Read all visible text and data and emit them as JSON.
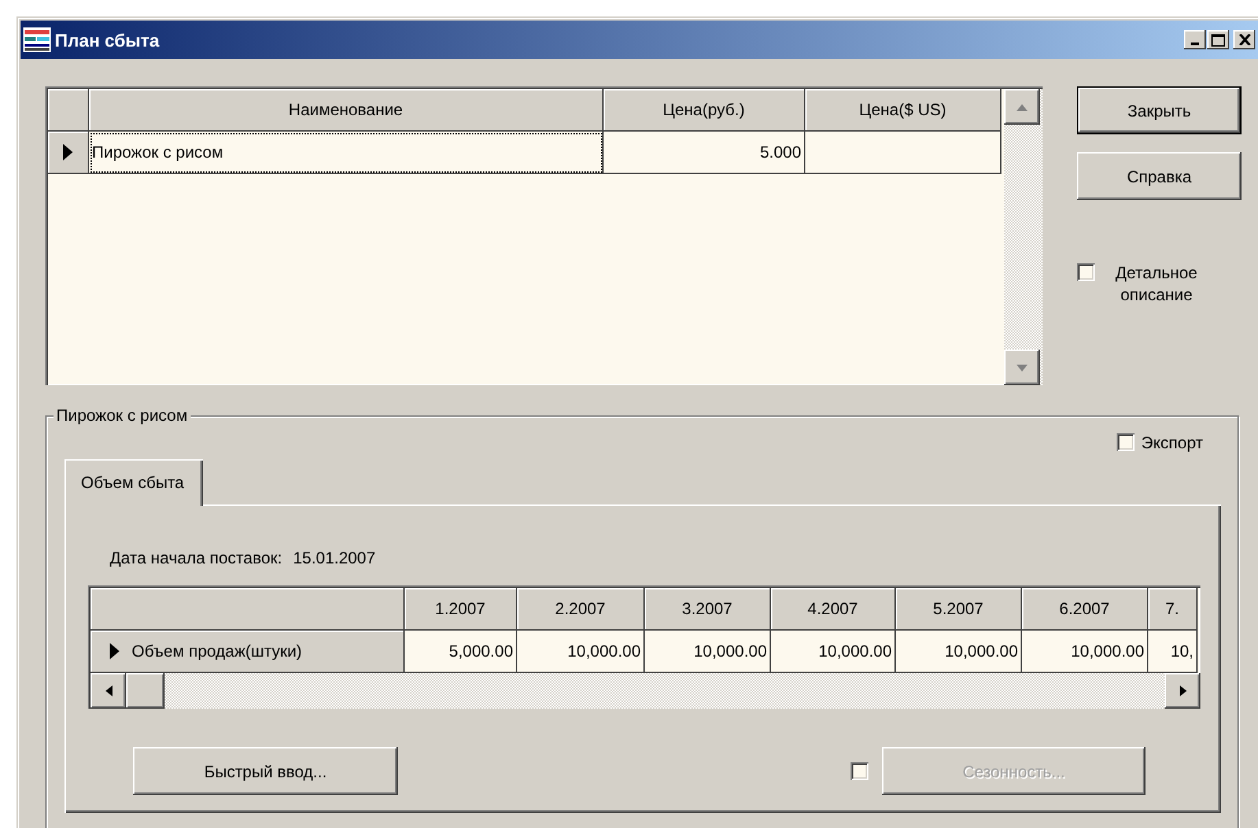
{
  "window": {
    "title": "План сбыта"
  },
  "products_table": {
    "columns": [
      "Наименование",
      "Цена(руб.)",
      "Цена($ US)"
    ],
    "rows": [
      {
        "selected": true,
        "cells": [
          "Пирожок с рисом",
          "5.000"
        ]
      }
    ]
  },
  "buttons": [
    {
      "label": "Закрыть",
      "default": true
    },
    {
      "label": "Справка",
      "default": false
    }
  ],
  "detail_checkbox": {
    "label": "Детальное описание",
    "checked": false
  },
  "group": {
    "title": "Пирожок с рисом"
  },
  "export_checkbox": {
    "label": "Экспорт",
    "checked": false
  },
  "tabs": [
    {
      "label": "Объем сбыта",
      "selected": true
    }
  ],
  "start_date": {
    "label": "Дата начала поставок:",
    "value": "15.01.2007"
  },
  "sales_table": {
    "columns": [
      "1.2007",
      "2.2007",
      "3.2007",
      "4.2007",
      "5.2007",
      "6.2007",
      "7."
    ],
    "rows": [
      {
        "label": "Объем продаж(штуки)",
        "selected": true,
        "values": [
          "5,000.00",
          "10,000.00",
          "10,000.00",
          "10,000.00",
          "10,000.00",
          "10,000.00",
          "10,"
        ]
      }
    ]
  },
  "quick_input_button": {
    "label": "Быстрый ввод..."
  },
  "seasonality": {
    "checked": false,
    "button": {
      "label": "Сезонность...",
      "disabled": true
    }
  }
}
